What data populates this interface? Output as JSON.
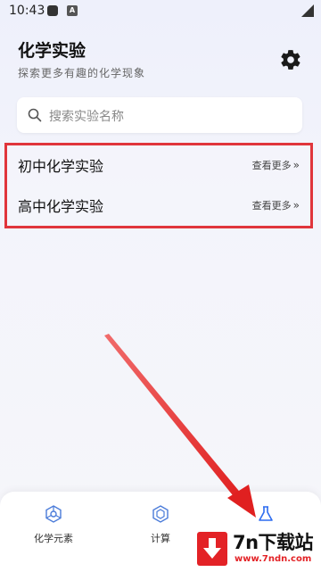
{
  "status_bar": {
    "time": "10:43",
    "icon_a_text": "A"
  },
  "header": {
    "title": "化学实验",
    "subtitle": "探索更多有趣的化学现象",
    "settings_icon": "gear-icon"
  },
  "search": {
    "placeholder": "搜索实验名称",
    "icon": "search-icon"
  },
  "categories": [
    {
      "title": "初中化学实验",
      "more_label": "查看更多"
    },
    {
      "title": "高中化学实验",
      "more_label": "查看更多"
    }
  ],
  "bottom_nav": {
    "items": [
      {
        "label": "化学元素",
        "icon": "atom-icon"
      },
      {
        "label": "计算",
        "icon": "hexagon-icon"
      },
      {
        "label": "",
        "icon": "flask-icon",
        "active": true
      }
    ]
  },
  "watermark": {
    "main": "7n下载站",
    "sub": "www.7ndn.com"
  },
  "colors": {
    "accent": "#2d6cf0",
    "highlight_border": "#e0353b",
    "watermark_red": "#e32226"
  }
}
